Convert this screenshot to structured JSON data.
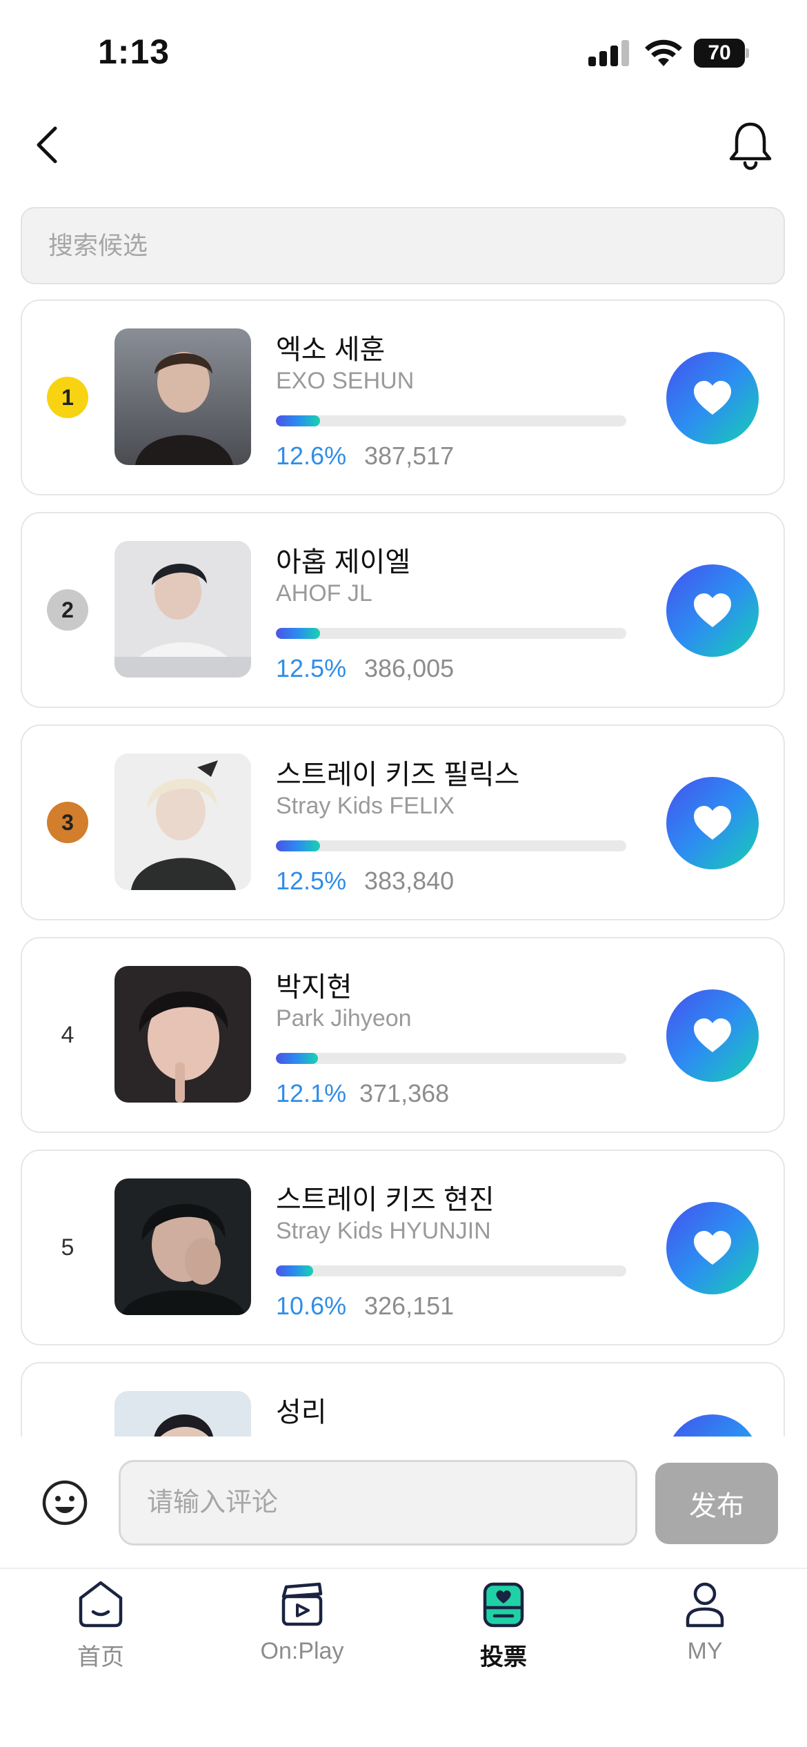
{
  "status_bar": {
    "time": "1:13",
    "battery": "70"
  },
  "header": {
    "back_icon": "chevron-left-icon",
    "bell_icon": "bell-icon"
  },
  "search": {
    "placeholder": "搜索候选",
    "value": ""
  },
  "candidates": [
    {
      "rank": "1",
      "name_ko": "엑소 세훈",
      "name_en": "EXO SEHUN",
      "percent": "12.6%",
      "votes": "387,517",
      "progress": 0.126,
      "badge_color": "#f7d311"
    },
    {
      "rank": "2",
      "name_ko": "아홉 제이엘",
      "name_en": "AHOF JL",
      "percent": "12.5%",
      "votes": "386,005",
      "progress": 0.125,
      "badge_color": "#c9c9c9"
    },
    {
      "rank": "3",
      "name_ko": "스트레이 키즈 필릭스",
      "name_en": "Stray Kids FELIX",
      "percent": "12.5%",
      "votes": "383,840",
      "progress": 0.125,
      "badge_color": "#d27e2c"
    },
    {
      "rank": "4",
      "name_ko": "박지현",
      "name_en": "Park Jihyeon",
      "percent": "12.1%",
      "votes": "371,368",
      "progress": 0.121
    },
    {
      "rank": "5",
      "name_ko": "스트레이 키즈 현진",
      "name_en": "Stray Kids HYUNJIN",
      "percent": "10.6%",
      "votes": "326,151",
      "progress": 0.106
    },
    {
      "rank": "",
      "name_ko": "성리",
      "name_en": "",
      "percent": "",
      "votes": "",
      "progress": 0
    }
  ],
  "comment": {
    "placeholder": "请输入评论",
    "value": "",
    "publish_label": "发布",
    "emoji_icon": "smiley-icon"
  },
  "tabs": [
    {
      "label": "首页",
      "icon": "home-icon",
      "active": false
    },
    {
      "label": "On:Play",
      "icon": "clapperboard-icon",
      "active": false
    },
    {
      "label": "投票",
      "icon": "vote-box-icon",
      "active": true
    },
    {
      "label": "MY",
      "icon": "person-icon",
      "active": false
    }
  ],
  "colors": {
    "accent_blue": "#2f8de8",
    "gradient_start": "#4452ee",
    "gradient_end": "#16cfb2",
    "vote_box_green": "#1fd1a5"
  }
}
